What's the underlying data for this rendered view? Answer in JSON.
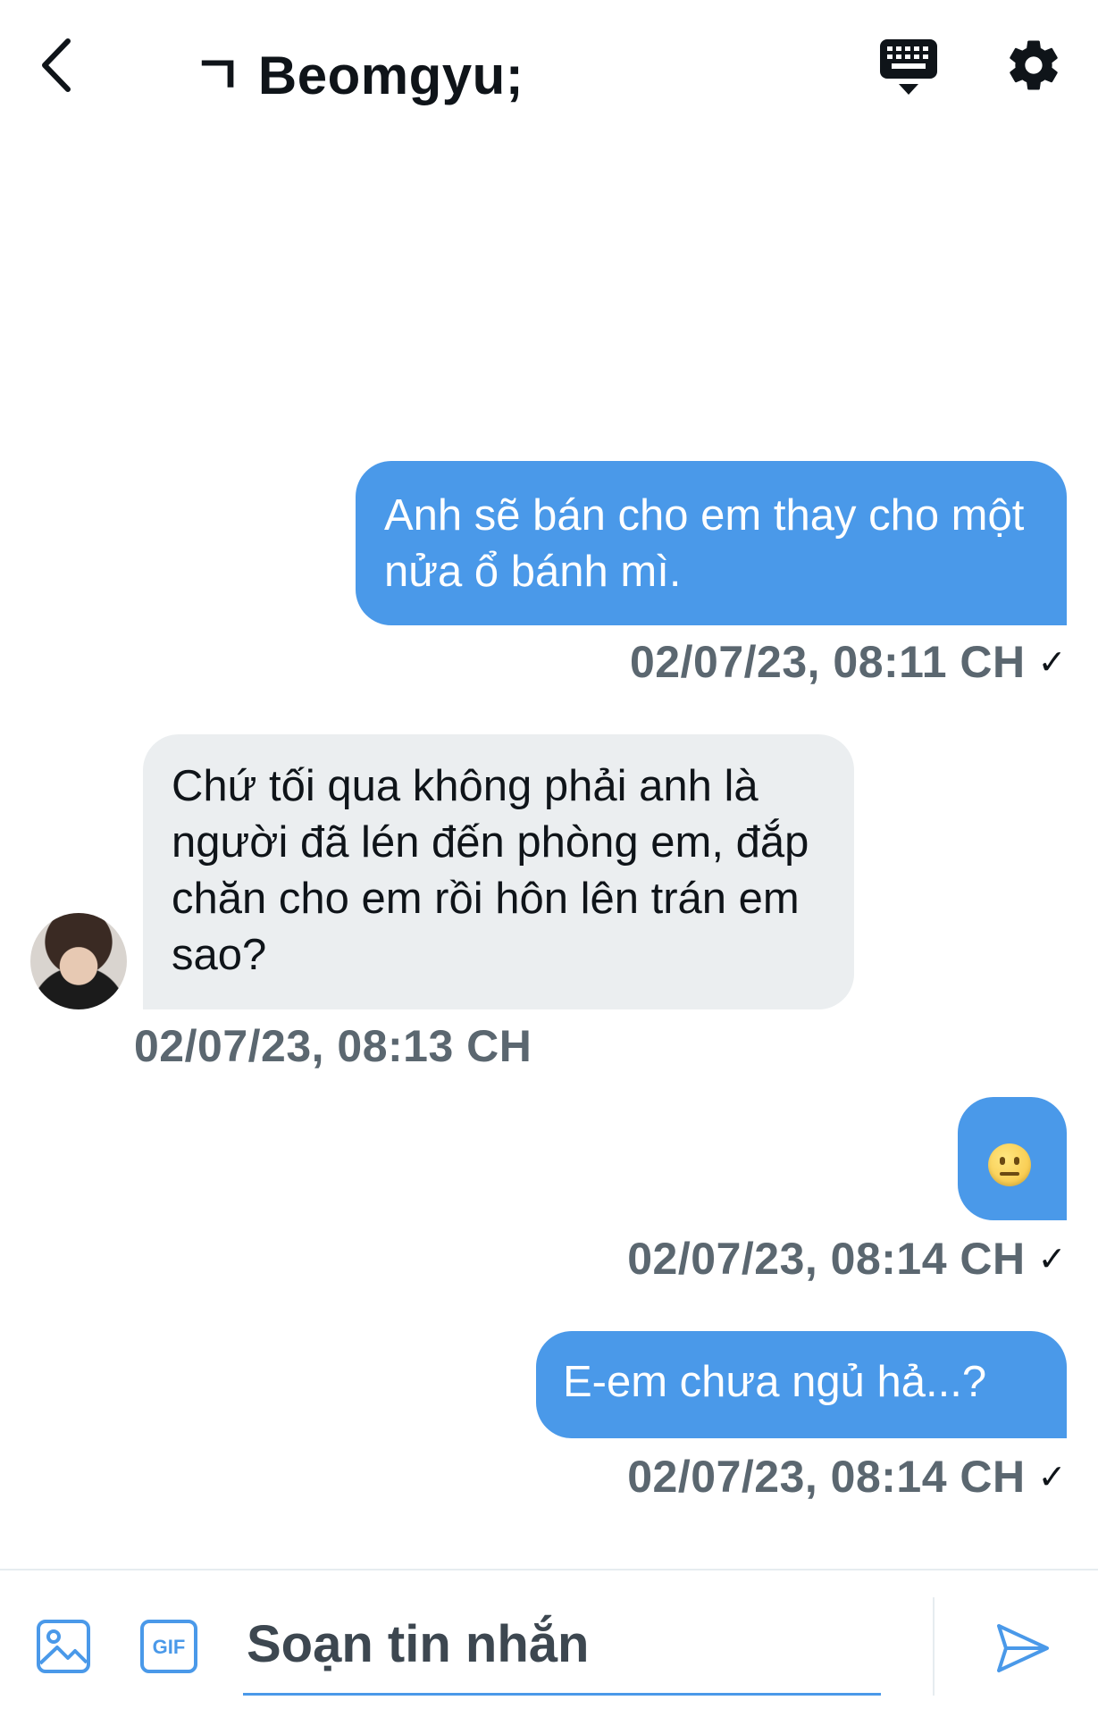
{
  "header": {
    "title": "ㄱ Beomgyu;",
    "back_icon": "chevron-left-icon",
    "keyboard_icon": "keyboard-icon",
    "settings_icon": "gear-icon"
  },
  "messages": [
    {
      "direction": "out",
      "text": "Anh sẽ bán cho em thay cho một nửa ổ bánh mì.",
      "timestamp": "02/07/23, 08:11 CH",
      "status": "✓"
    },
    {
      "direction": "in",
      "text": "Chứ tối qua không phải anh là người đã lén đến phòng em, đắp chăn cho em rồi hôn lên trán em sao?",
      "timestamp": "02/07/23, 08:13 CH"
    },
    {
      "direction": "out",
      "text": "😐",
      "timestamp": "02/07/23, 08:14 CH",
      "status": "✓"
    },
    {
      "direction": "out",
      "text": "E-em chưa ngủ hả...?",
      "timestamp": "02/07/23, 08:14 CH",
      "status": "✓"
    }
  ],
  "composer": {
    "placeholder": "Soạn tin nhắn",
    "gif_label": "GIF",
    "media_icon": "image-icon",
    "send_icon": "send-icon"
  },
  "colors": {
    "accent": "#4a99e9",
    "incoming_bubble": "#ebeef0",
    "timestamp": "#5b6770"
  }
}
